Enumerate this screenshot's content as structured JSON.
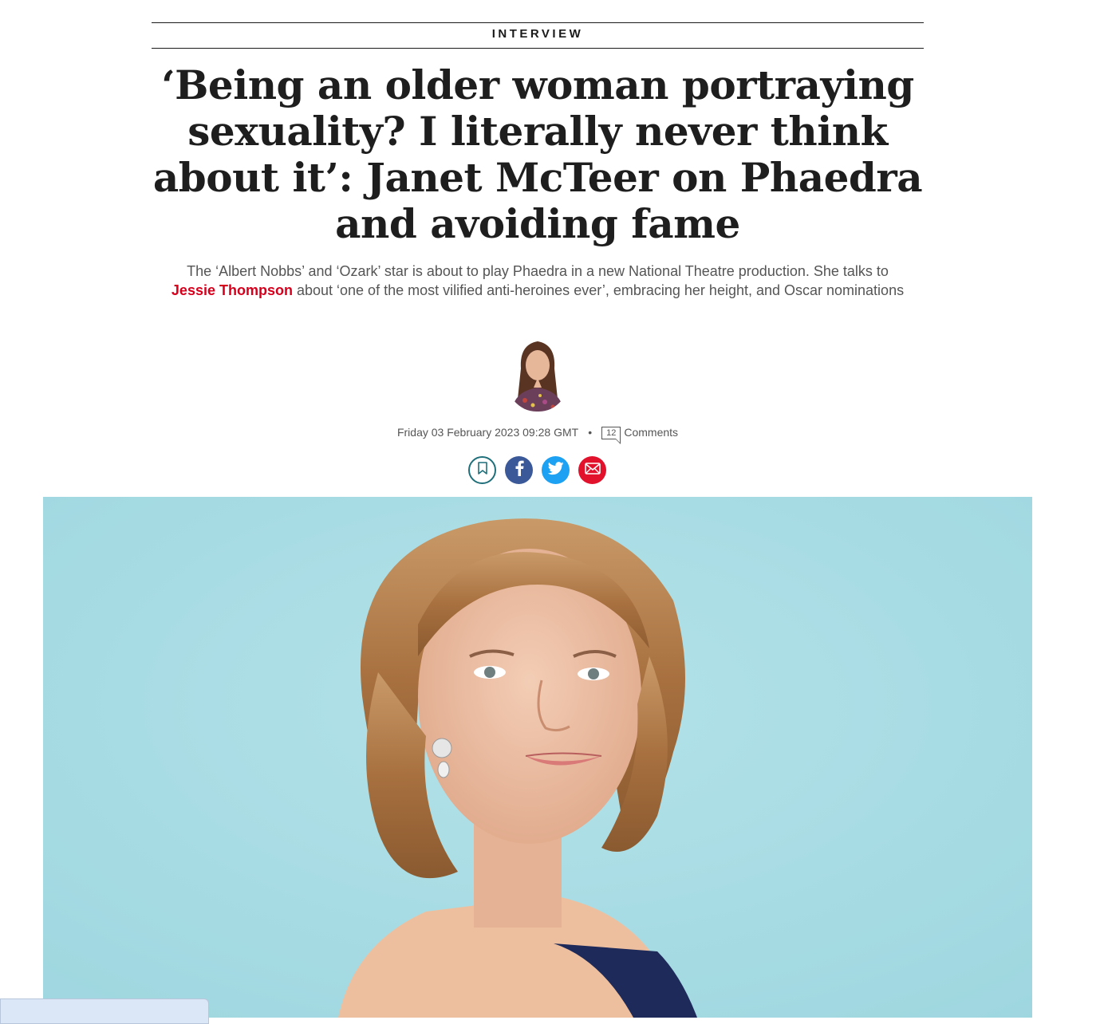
{
  "article": {
    "kicker": "INTERVIEW",
    "headline": "‘Being an older woman portraying sexuality? I literally never think about it’: Janet McTeer on Phaedra and avoiding fame",
    "standfirst_before": "The ‘Albert Nobbs’ and ‘Ozark’ star is about to play Phaedra in a new National Theatre production. She talks to",
    "author": "Jessie Thompson",
    "standfirst_after": "about ‘one of the most vilified anti-heroines ever’, embracing her height, and Oscar nominations",
    "date": "Friday 03 February 2023 09:28 GMT",
    "separator": "•",
    "comment_count": "12",
    "comments_label": "Comments"
  },
  "share": {
    "bookmark_icon": "bookmark-icon",
    "facebook_icon": "facebook-icon",
    "twitter_icon": "twitter-icon",
    "email_icon": "email-icon"
  },
  "colors": {
    "author_link": "#d6001c",
    "facebook": "#3b5998",
    "twitter": "#1da1f2",
    "email": "#e2112c",
    "bookmark_border": "#1f6f7a",
    "hero_background": "#aadce4"
  }
}
